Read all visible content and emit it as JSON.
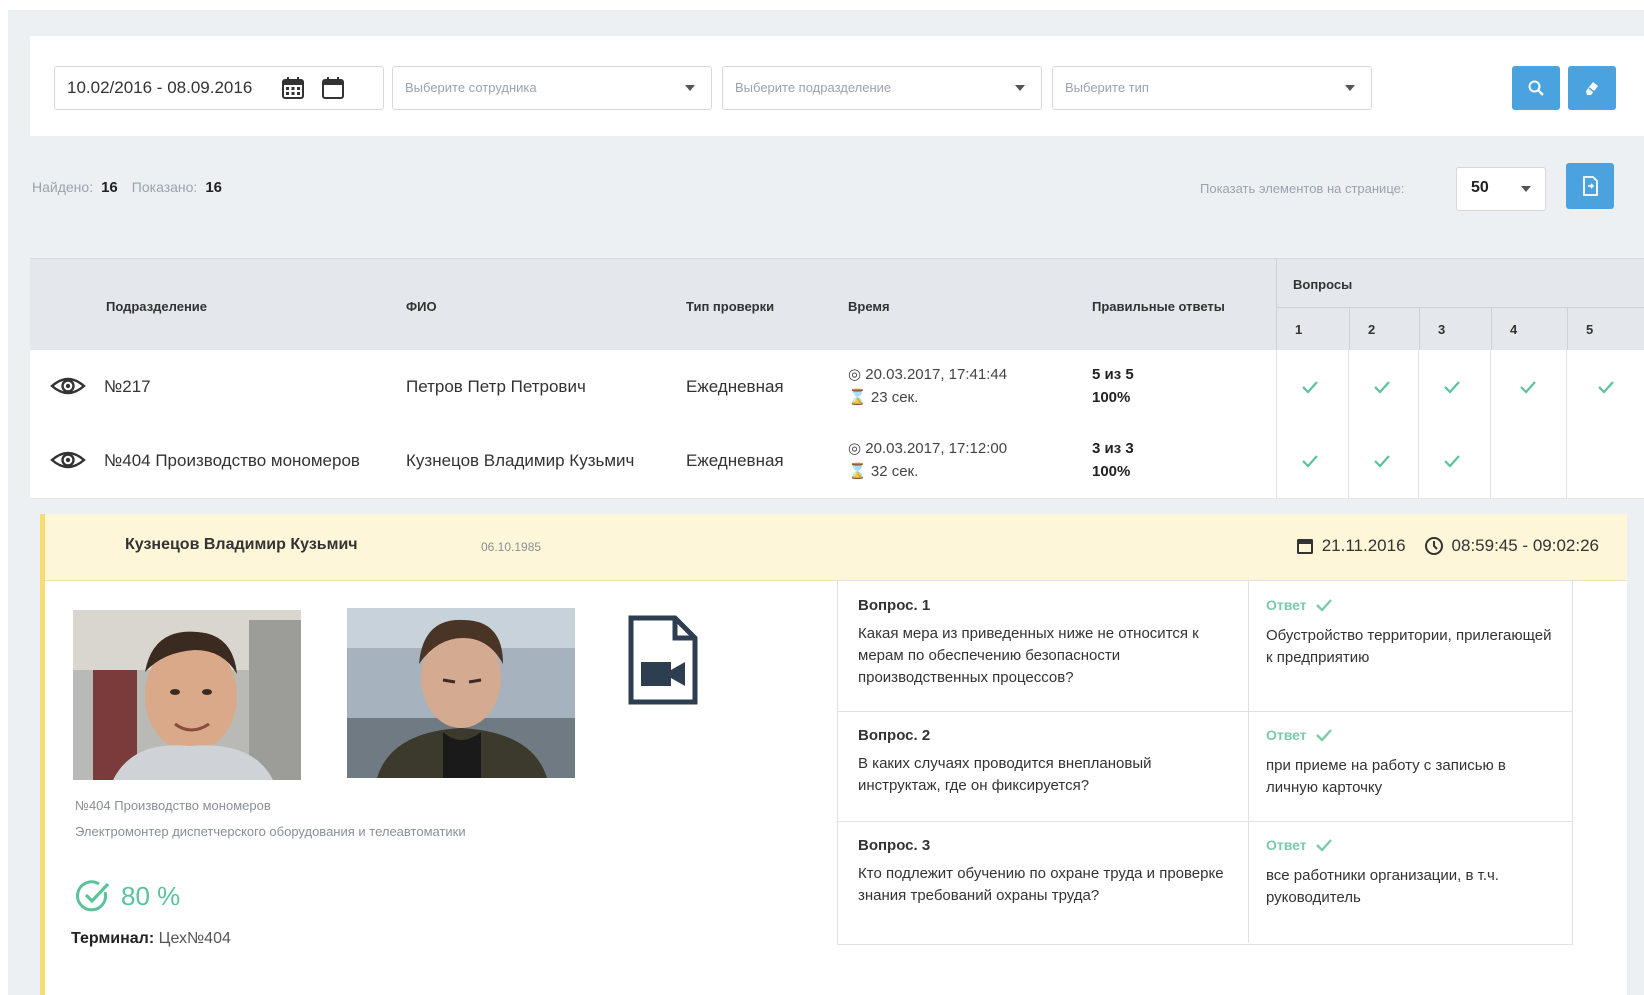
{
  "filters": {
    "date_range": "10.02/2016 - 08.09.2016",
    "employee_placeholder": "Выберите сотрудника",
    "department_placeholder": "Выберите подразделение",
    "type_placeholder": "Выберите тип"
  },
  "counts": {
    "found_label": "Найдено:",
    "found_value": "16",
    "shown_label": "Показано:",
    "shown_value": "16",
    "per_page_label": "Показать элементов на странице:",
    "per_page_value": "50"
  },
  "table": {
    "headers": {
      "department": "Подразделение",
      "name": "ФИО",
      "check_type": "Тип проверки",
      "time": "Время",
      "correct": "Правильные ответы",
      "questions": "Вопросы"
    },
    "question_numbers": [
      "1",
      "2",
      "3",
      "4",
      "5"
    ],
    "rows": [
      {
        "department": "№217",
        "name": "Петров Петр Петрович",
        "type": "Ежедневная",
        "datetime": "20.03.2017, 17:41:44",
        "duration": "23 сек.",
        "score": "5 из 5",
        "percent": "100%",
        "answers": [
          true,
          true,
          true,
          true,
          true
        ]
      },
      {
        "department": "№404 Производство мономеров",
        "name": "Кузнецов Владимир Кузьмич",
        "type": "Ежедневная",
        "datetime": "20.03.2017, 17:12:00",
        "duration": "32 сек.",
        "score": "3 из 3",
        "percent": "100%",
        "answers": [
          true,
          true,
          true
        ]
      }
    ]
  },
  "detail": {
    "name": "Кузнецов Владимир Кузьмич",
    "dob": "06.10.1985",
    "date": "21.11.2016",
    "time_range": "08:59:45 - 09:02:26",
    "department": "№404 Производство мономеров",
    "position": "Электромонтер диспетчерского оборудования и телеавтоматики",
    "percent": "80 %",
    "terminal_label": "Терминал:",
    "terminal_value": "Цех№404",
    "answer_label": "Ответ",
    "questions": [
      {
        "title": "Вопрос. 1",
        "text": "Какая мера из приведенных ниже не относится к мерам по обеспечению безопасности производственных процессов?",
        "answer": "Обустройство территории, прилегающей к предприятию"
      },
      {
        "title": "Вопрос. 2",
        "text": "В каких случаях проводится внеплановый инструктаж, где он фиксируется?",
        "answer": "при приеме на работу с записью в личную карточку"
      },
      {
        "title": "Вопрос. 3",
        "text": "Кто подлежит обучению по охране труда и проверке знания требований охраны труда?",
        "answer": "все работники организации, в т.ч. руководитель"
      }
    ]
  },
  "colors": {
    "accent": "#4aa3df",
    "success": "#5bc39a",
    "highlight": "#fdf6d8"
  }
}
